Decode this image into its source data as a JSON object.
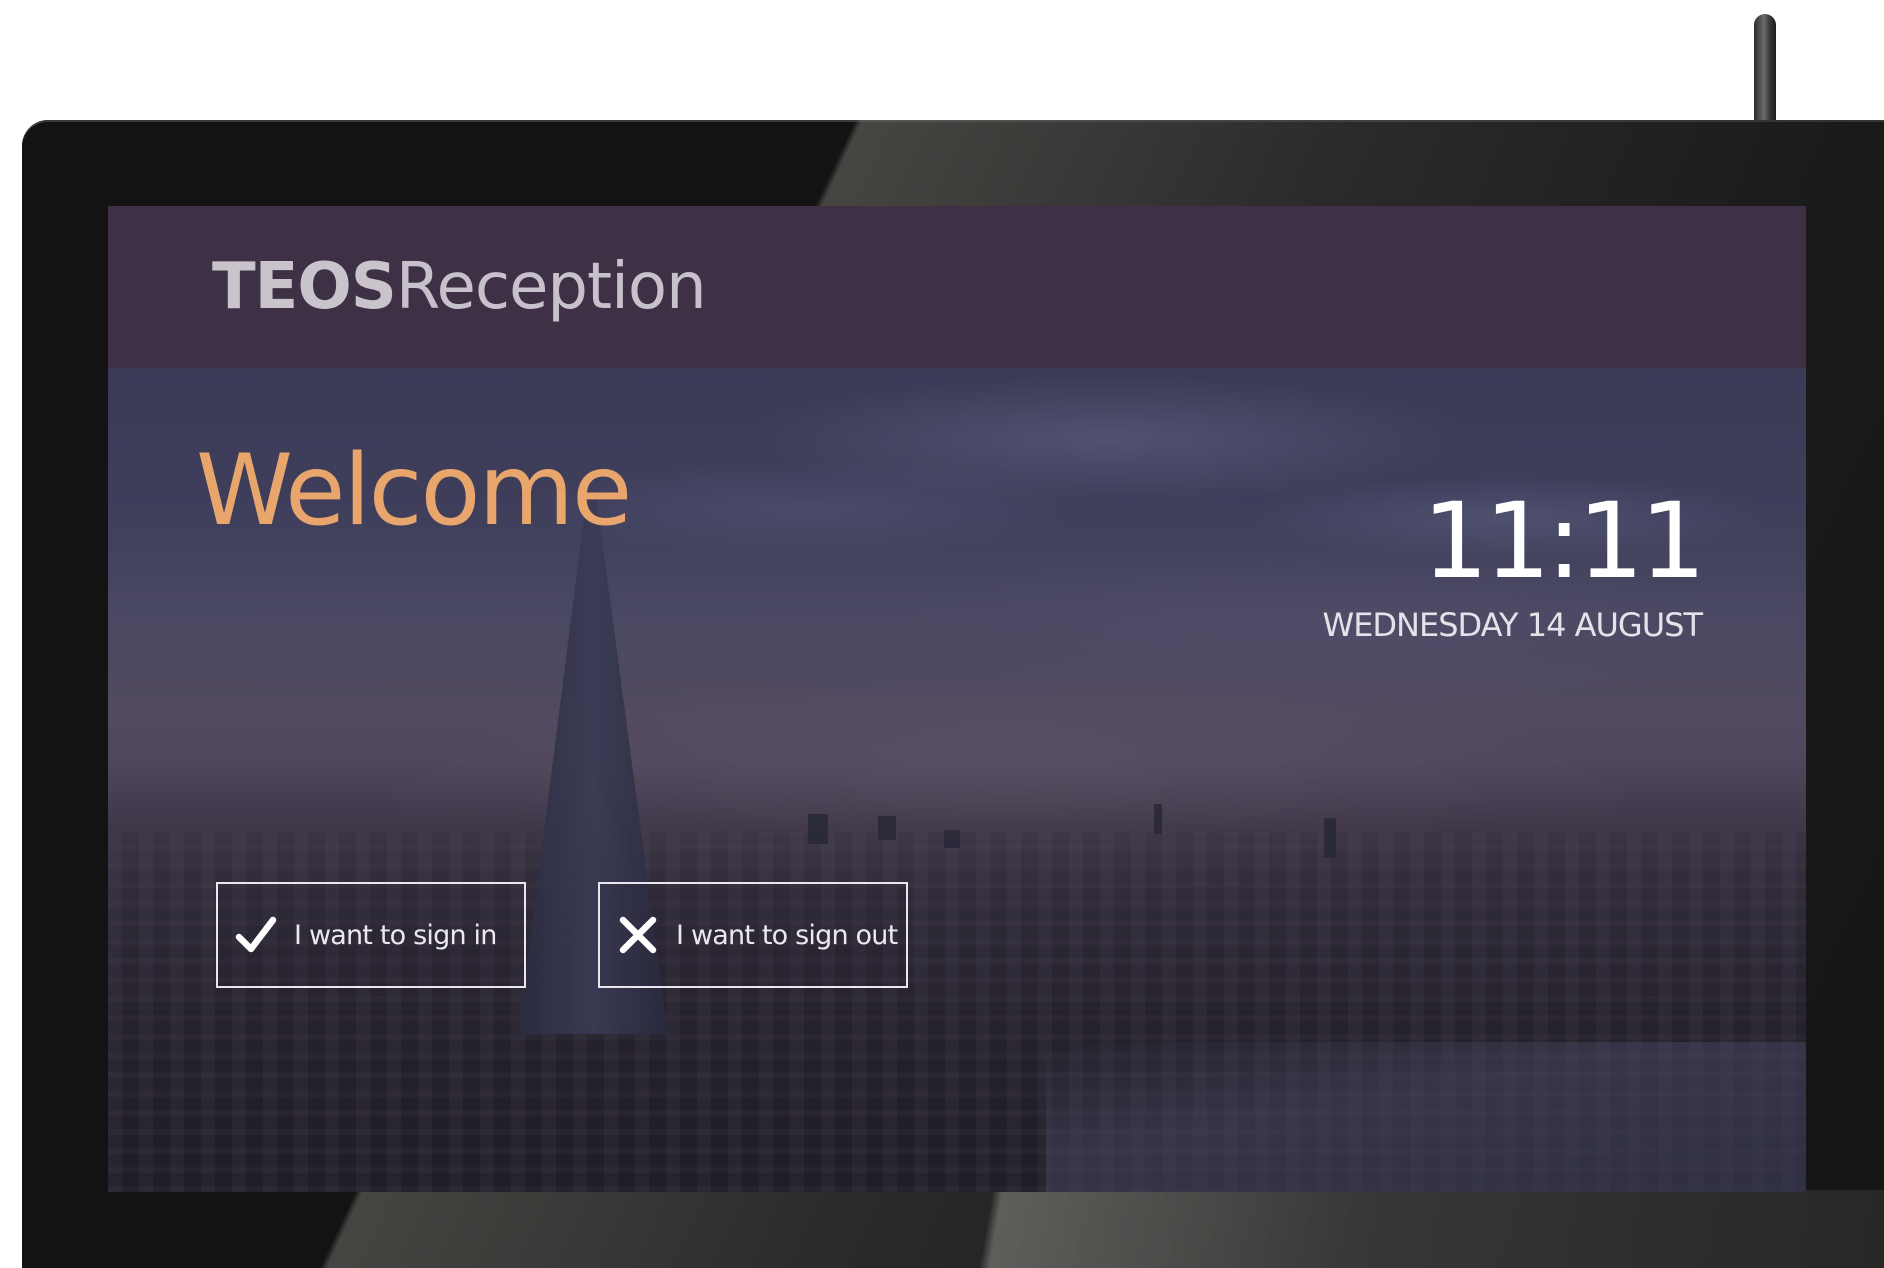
{
  "app": {
    "brand_bold": "TEOS",
    "brand_light": "Reception"
  },
  "main": {
    "welcome": "Welcome",
    "time": "11:11",
    "date": "WEDNESDAY 14 AUGUST"
  },
  "actions": {
    "sign_in": {
      "label": "I want to sign in",
      "icon": "checkmark-icon"
    },
    "sign_out": {
      "label": "I want to sign out",
      "icon": "close-icon"
    }
  },
  "colors": {
    "header_bg": "#3e3045",
    "welcome_accent": "#e8a56c",
    "text_light": "#ffffff",
    "button_border": "#e9e6ec",
    "bezel": "#131313"
  }
}
